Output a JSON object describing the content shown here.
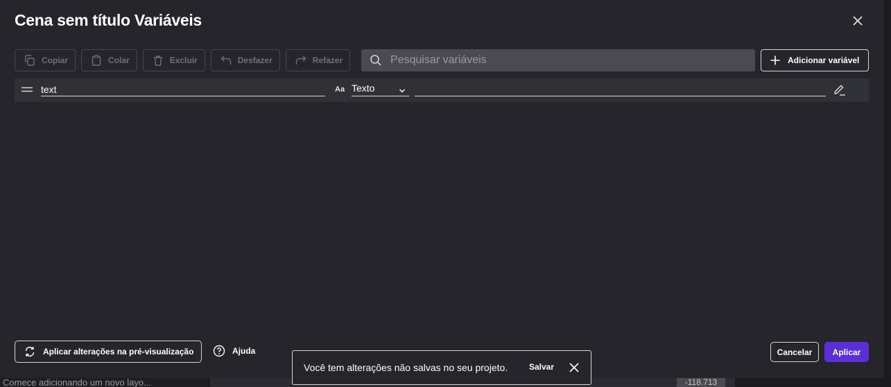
{
  "dialog": {
    "title": "Cena sem título Variáveis"
  },
  "toolbar": {
    "copy_label": "Copiar",
    "paste_label": "Colar",
    "delete_label": "Excluir",
    "undo_label": "Desfazer",
    "redo_label": "Refazer",
    "search_placeholder": "Pesquisar variáveis",
    "add_label": "Adicionar variável"
  },
  "variables": [
    {
      "name": "text",
      "type_icon": "Aa",
      "type": "Texto",
      "value": ""
    }
  ],
  "footer": {
    "apply_preview_label": "Aplicar alterações na pré-visualização",
    "help_label": "Ajuda",
    "cancel_label": "Cancelar",
    "apply_label": "Aplicar"
  },
  "toast": {
    "message": "Você tem alterações não salvas no seu projeto.",
    "save_label": "Salvar"
  },
  "background": {
    "layer_hint": "Comece adicionando um novo layo...",
    "coord": "-118.713"
  },
  "colors": {
    "accent": "#5b2fd8",
    "dialog_bg": "#25252b",
    "search_bg": "#4a4a52"
  }
}
